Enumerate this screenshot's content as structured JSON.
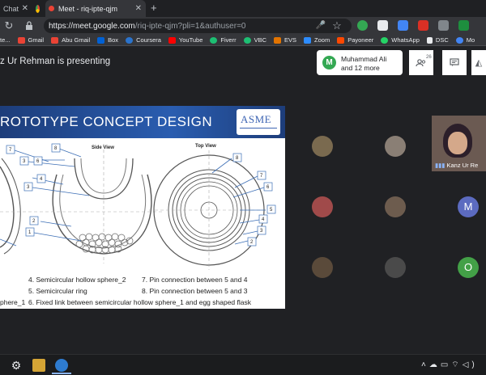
{
  "browser": {
    "tabs": [
      {
        "label": "Chat"
      },
      {
        "label": "Meet - riq-ipte-qjm",
        "active": true
      }
    ],
    "new_tab_label": "+",
    "url_host": "https://meet.google.com",
    "url_path": "/riq-ipte-qjm?pli=1&authuser=0",
    "bookmarks": [
      {
        "label": "te..."
      },
      {
        "label": "Gmail",
        "icon": "gmail-icon",
        "color": "#ea4335"
      },
      {
        "label": "Abu Gmail",
        "icon": "gmail-icon",
        "color": "#ea4335"
      },
      {
        "label": "Box",
        "icon": "box-icon",
        "color": "#0061d5"
      },
      {
        "label": "Coursera",
        "icon": "coursera-icon",
        "color": "#2a73cc"
      },
      {
        "label": "YouTube",
        "icon": "youtube-icon",
        "color": "#ff0000"
      },
      {
        "label": "Fiverr",
        "icon": "fiverr-icon",
        "color": "#1dbf73"
      },
      {
        "label": "VBC",
        "icon": "vbc-icon",
        "color": "#1dbf73"
      },
      {
        "label": "EVS",
        "icon": "evs-icon",
        "color": "#e37400"
      },
      {
        "label": "Zoom",
        "icon": "zoom-icon",
        "color": "#2d8cff"
      },
      {
        "label": "Payoneer",
        "icon": "payoneer-icon",
        "color": "#ff4800"
      },
      {
        "label": "WhatsApp",
        "icon": "whatsapp-icon",
        "color": "#25d366"
      },
      {
        "label": "DSC",
        "icon": "page-icon",
        "color": "#e8eaed"
      },
      {
        "label": "Mo",
        "icon": "chrome-icon",
        "color": "#4285f4"
      }
    ]
  },
  "meet": {
    "presenting_text": "z Ur Rehman is presenting",
    "people_card": {
      "initial": "M",
      "name": "Muhammad Ali",
      "more": "and 12 more"
    },
    "participant_count": "26",
    "speaker_name": "Kanz Ur Re",
    "participant_initials": {
      "m": "M",
      "o": "O"
    }
  },
  "slide": {
    "title": "ROTOTYPE CONCEPT DESIGN",
    "logo": "ASME",
    "side_view_label": "Side View",
    "top_view_label": "Top View",
    "side_numbers": [
      "7",
      "8",
      "6",
      "3",
      "4",
      "5",
      "2",
      "1"
    ],
    "top_numbers": [
      "8",
      "7",
      "6",
      "5",
      "4",
      "3",
      "2"
    ],
    "legend": [
      "4.  Semicircular hollow sphere_2",
      "7.  Pin connection between 5 and 4",
      "5.  Semicircular ring",
      "8.  Pin connection between 5 and 3",
      "phere_1",
      "6.  Fixed link between semicircular hollow sphere_1 and egg shaped flask"
    ]
  },
  "colors": {
    "slide_header": "#2a5db0",
    "meet_bg": "#202124",
    "avatar_m": "#5c6bc0",
    "avatar_o": "#43a047"
  }
}
